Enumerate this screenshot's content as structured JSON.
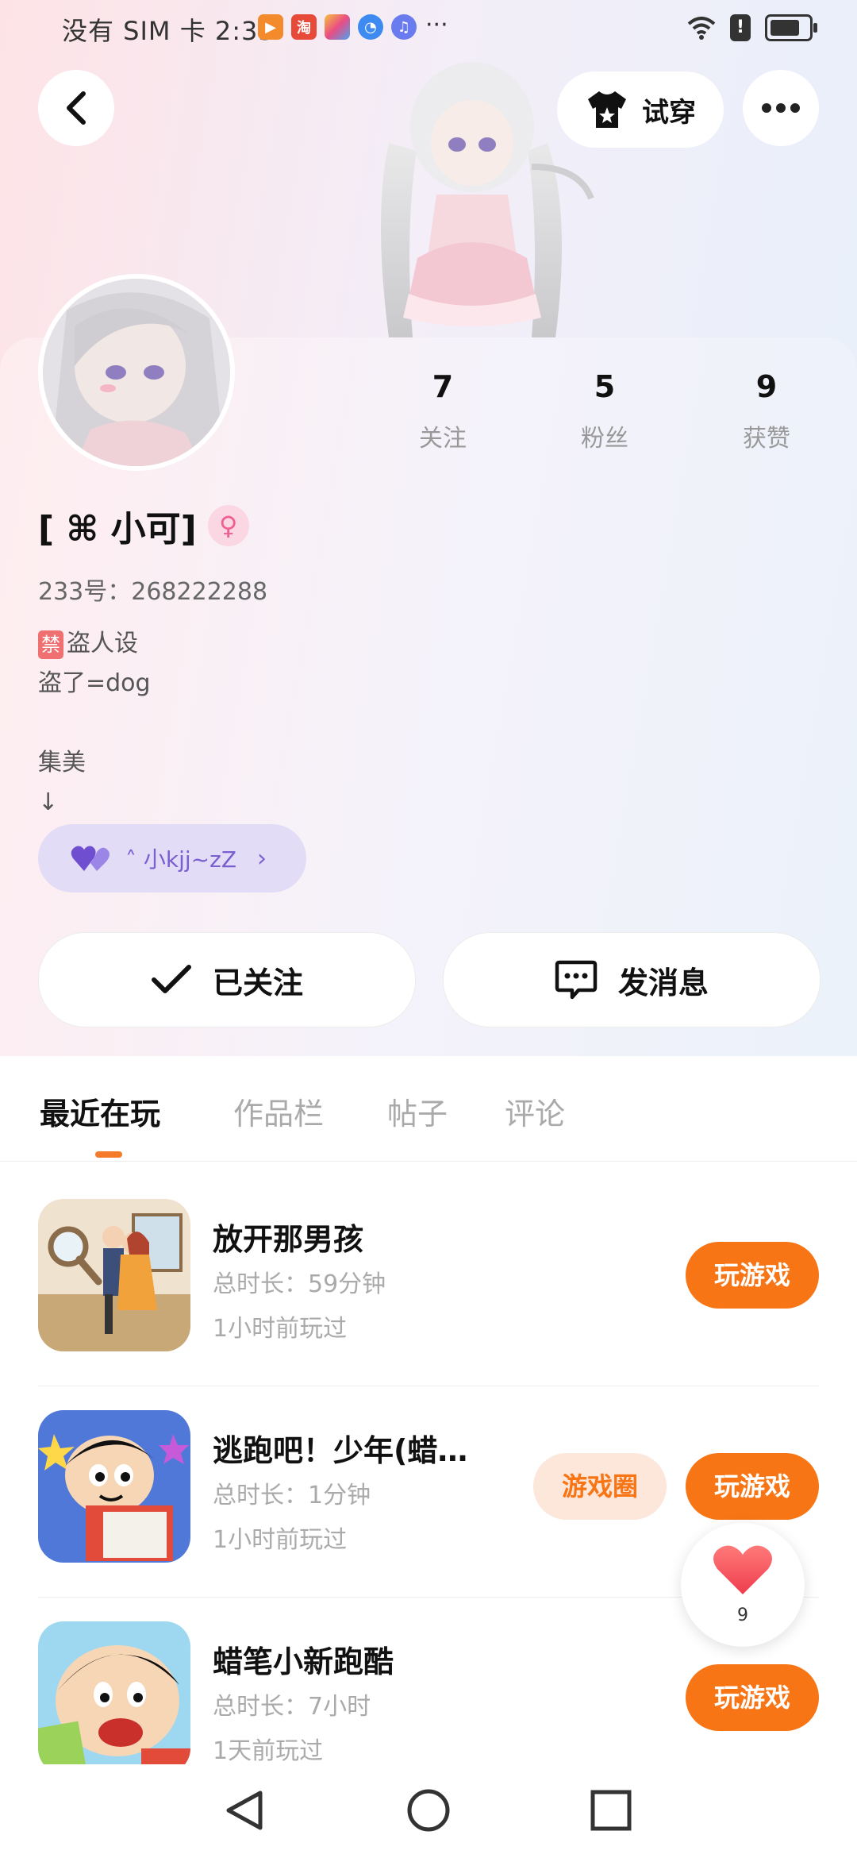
{
  "status_bar": {
    "left_text": "没有 SIM 卡 2:33",
    "more": "···",
    "notif_icons": [
      "video-app-icon",
      "taobao-icon",
      "store-app-icon",
      "browser-icon",
      "music-icon"
    ],
    "taobao_char": "淘",
    "alert_char": "!"
  },
  "header": {
    "try_on_label": "试穿"
  },
  "profile": {
    "stats": [
      {
        "value": "7",
        "label": "关注"
      },
      {
        "value": "5",
        "label": "粉丝"
      },
      {
        "value": "9",
        "label": "获赞"
      }
    ],
    "nickname": "[ ⌘ 小可]",
    "gender_symbol": "♀",
    "user_id": "233号：268222288",
    "bio_tag": "禁",
    "bio_lines": [
      "盗人设",
      "盗了=dog",
      "",
      "集美",
      "↓"
    ],
    "cp_name": "˄ 小kjj~zZ",
    "follow_label": "已关注",
    "message_label": "发消息"
  },
  "tabs": [
    {
      "label": "最近在玩",
      "active": true
    },
    {
      "label": "作品栏",
      "active": false
    },
    {
      "label": "帖子",
      "active": false
    },
    {
      "label": "评论",
      "active": false
    }
  ],
  "games": [
    {
      "title": "放开那男孩",
      "duration": "总时长：59分钟",
      "last_played": "1小时前玩过",
      "play_label": "玩游戏"
    },
    {
      "title": "逃跑吧！少年(蜡…",
      "duration": "总时长：1分钟",
      "last_played": "1小时前玩过",
      "circle_label": "游戏圈",
      "play_label": "玩游戏"
    },
    {
      "title": "蜡笔小新跑酷",
      "duration": "总时长：7小时",
      "last_played": "1天前玩过",
      "play_label": "玩游戏"
    }
  ],
  "like_float": {
    "count": "9"
  },
  "colors": {
    "accent_orange": "#f77515",
    "cp_purple": "#7a5fd0",
    "gender_pink": "#ef5f93"
  }
}
